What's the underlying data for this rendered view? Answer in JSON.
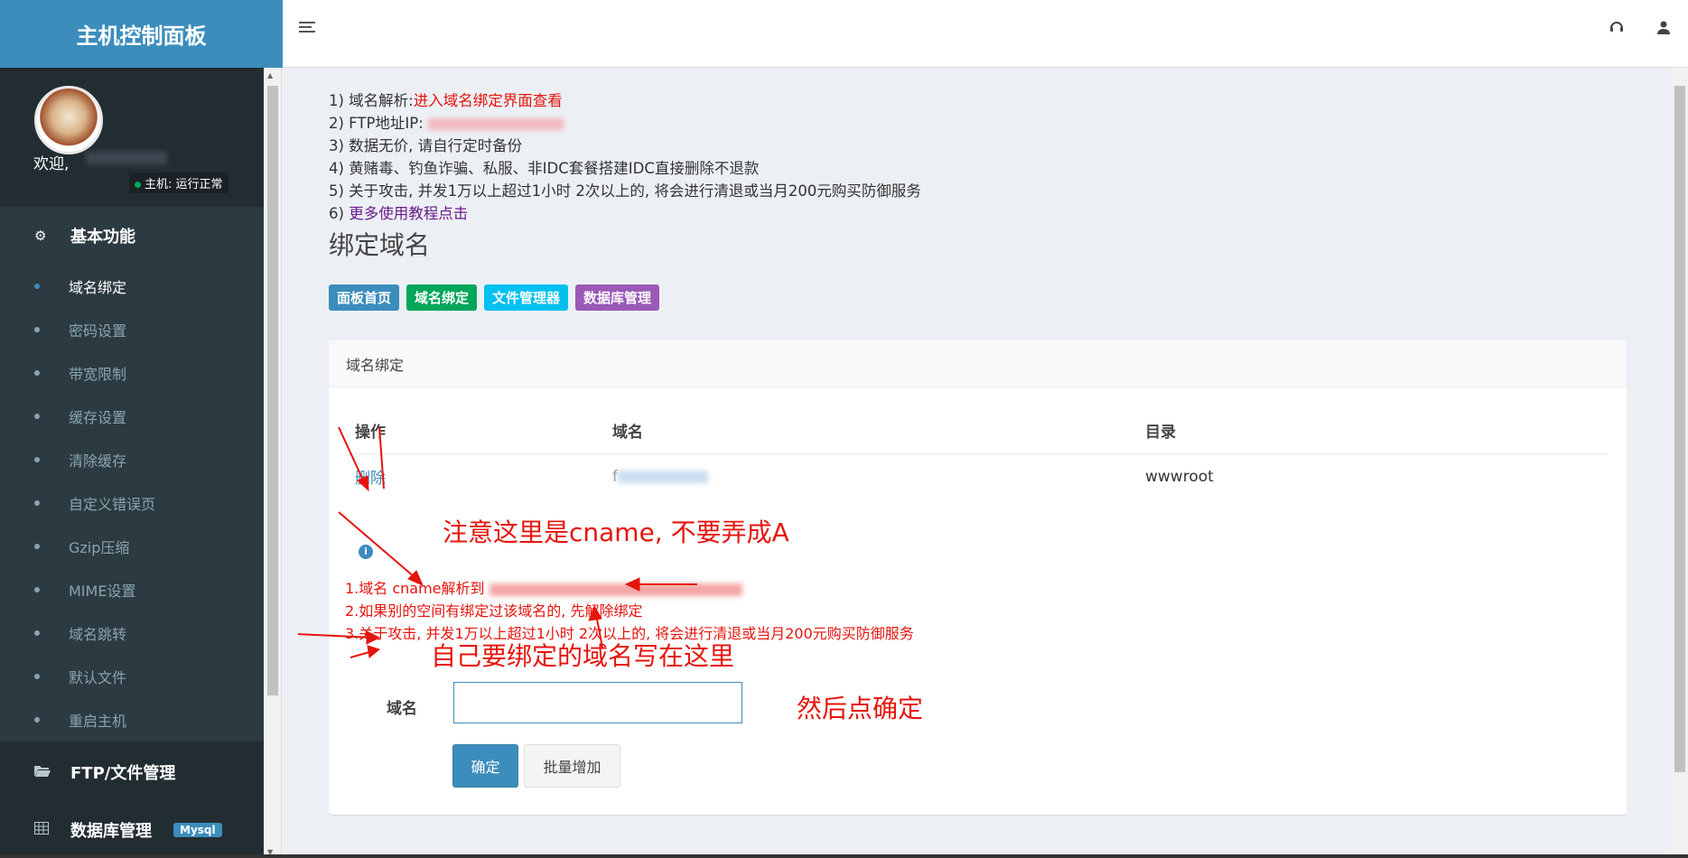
{
  "brand": {
    "title": "主机控制面板"
  },
  "topbar": {
    "menu_icon": "hamburger-icon",
    "support_icon": "headset-icon",
    "user_icon": "user-icon"
  },
  "user": {
    "welcome": "欢迎,",
    "status": "主机: 运行正常"
  },
  "sidebar": {
    "section_basic": "基本功能",
    "items": [
      {
        "label": "域名绑定"
      },
      {
        "label": "密码设置"
      },
      {
        "label": "带宽限制"
      },
      {
        "label": "缓存设置"
      },
      {
        "label": "清除缓存"
      },
      {
        "label": "自定义错误页"
      },
      {
        "label": "Gzip压缩"
      },
      {
        "label": "MIME设置"
      },
      {
        "label": "域名跳转"
      },
      {
        "label": "默认文件"
      },
      {
        "label": "重启主机"
      }
    ],
    "section_ftp": "FTP/文件管理",
    "section_db": "数据库管理",
    "db_badge": "Mysql"
  },
  "notes": {
    "n1_prefix": "1) 域名解析:",
    "n1_link": "进入域名绑定界面查看",
    "n2": "2) FTP地址IP:",
    "n3": "3) 数据无价, 请自行定时备份",
    "n4": "4) 黄赌毒、钓鱼诈骗、私服、非IDC套餐搭建IDC直接删除不退款",
    "n5": "5) 关于攻击, 并发1万以上超过1小时 2次以上的, 将会进行清退或当月200元购买防御服务",
    "n6_prefix": "6)",
    "n6_link": "更多使用教程点击"
  },
  "page": {
    "title": "绑定域名"
  },
  "quick_links": [
    {
      "label": "面板首页",
      "color": "#3c8dbc"
    },
    {
      "label": "域名绑定",
      "color": "#00a65a"
    },
    {
      "label": "文件管理器",
      "color": "#00c0ef"
    },
    {
      "label": "数据库管理",
      "color": "#9b59b6"
    }
  ],
  "box": {
    "title": "域名绑定",
    "columns": [
      "操作",
      "域名",
      "目录"
    ],
    "rows": [
      {
        "action": "删除",
        "domain": "f",
        "dir": "wwwroot"
      }
    ]
  },
  "rules": {
    "r1": "1.域名 cname解析到",
    "r2": "2.如果别的空间有绑定过该域名的, 先解除绑定",
    "r3": "3.关于攻击, 并发1万以上超过1小时 2次以上的, 将会进行清退或当月200元购买防御服务"
  },
  "form": {
    "label": "域名",
    "value": "",
    "ok": "确定",
    "batch": "批量增加"
  },
  "annotations": {
    "a1": "注意这里是cname, 不要弄成A",
    "a2": "自己要绑定的域名写在这里",
    "a3": "然后点确定"
  }
}
